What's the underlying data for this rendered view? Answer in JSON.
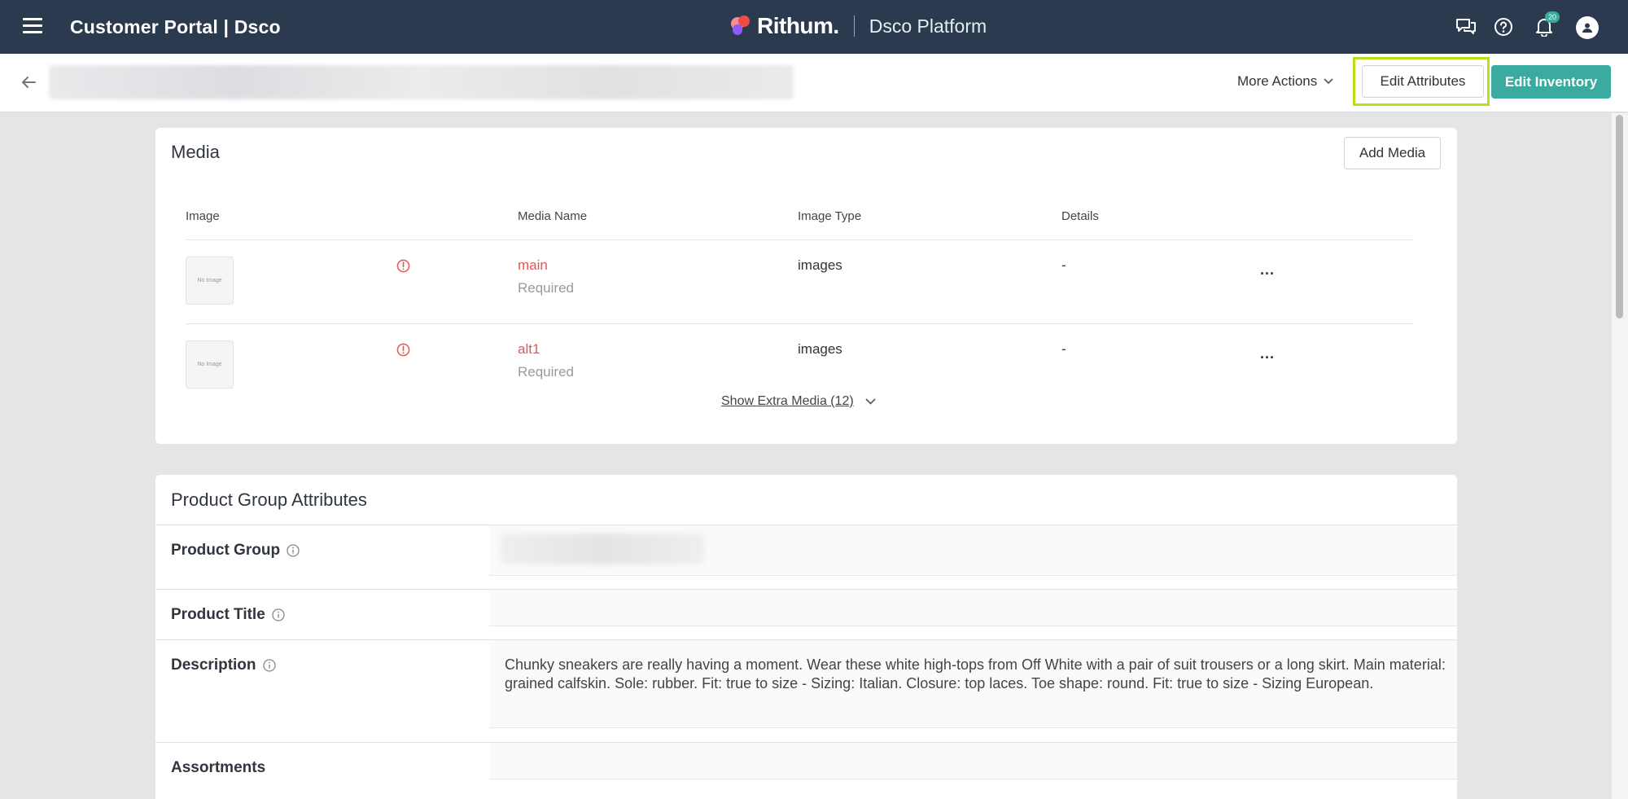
{
  "topnav": {
    "app_title": "Customer Portal | Dsco",
    "brand_name": "Rithum.",
    "brand_platform": "Dsco Platform",
    "notification_count": "20",
    "icons": [
      "menu-icon",
      "chat-icon",
      "help-icon",
      "bell-icon",
      "user-icon"
    ]
  },
  "actionbar": {
    "more_actions": "More Actions",
    "edit_attributes": "Edit Attributes",
    "edit_inventory": "Edit Inventory"
  },
  "media": {
    "title": "Media",
    "add_media": "Add Media",
    "columns": [
      "Image",
      "Media Name",
      "Image Type",
      "Details"
    ],
    "rows": [
      {
        "thumb": "No Image",
        "name": "main",
        "status": "Required",
        "type": "images",
        "details": "-",
        "menu": "..."
      },
      {
        "thumb": "No Image",
        "name": "alt1",
        "status": "Required",
        "type": "images",
        "details": "-",
        "menu": "..."
      }
    ],
    "show_extra": "Show Extra Media (12)"
  },
  "attributes": {
    "title": "Product Group Attributes",
    "rows": [
      {
        "label": "Product Group",
        "value": ""
      },
      {
        "label": "Product Title",
        "value": ""
      },
      {
        "label": "Description",
        "value": "Chunky sneakers are really having a moment. Wear these white high-tops from Off White with a pair of suit trousers or a long skirt. Main material: grained calfskin. Sole: rubber. Fit: true to size - Sizing: Italian. Closure: top laces. Toe shape: round. Fit: true to size - Sizing European."
      },
      {
        "label": "Assortments",
        "value": ""
      }
    ]
  },
  "colors": {
    "nav_bg": "#2b3a4f",
    "primary": "#3bab9f",
    "error": "#e45656",
    "highlight": "#b6e21c"
  }
}
